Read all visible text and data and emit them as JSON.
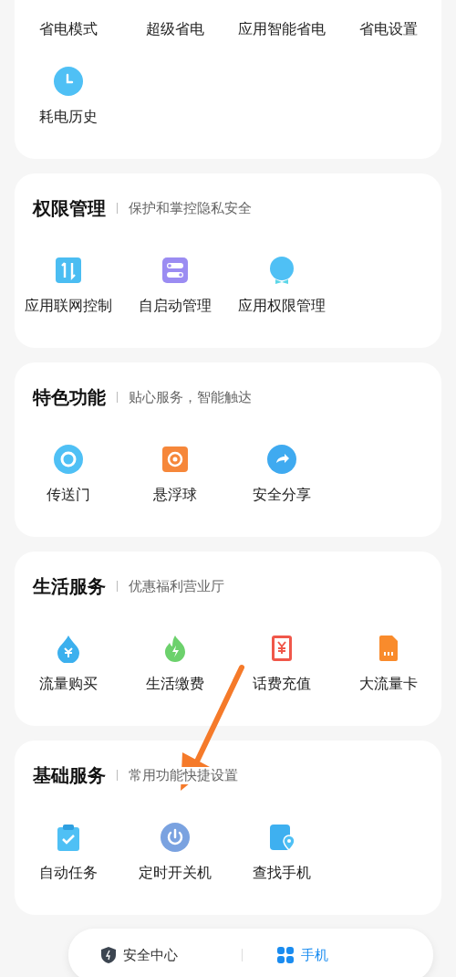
{
  "sections": [
    {
      "items": [
        {
          "label": "省电模式"
        },
        {
          "label": "超级省电"
        },
        {
          "label": "应用智能省电"
        },
        {
          "label": "省电设置"
        },
        {
          "label": "耗电历史"
        }
      ]
    },
    {
      "title": "权限管理",
      "subtitle": "保护和掌控隐私安全",
      "items": [
        {
          "label": "应用联网控制"
        },
        {
          "label": "自启动管理"
        },
        {
          "label": "应用权限管理"
        }
      ]
    },
    {
      "title": "特色功能",
      "subtitle": "贴心服务，智能触达",
      "items": [
        {
          "label": "传送门"
        },
        {
          "label": "悬浮球"
        },
        {
          "label": "安全分享"
        }
      ]
    },
    {
      "title": "生活服务",
      "subtitle": "优惠福利营业厅",
      "items": [
        {
          "label": "流量购买"
        },
        {
          "label": "生活缴费"
        },
        {
          "label": "话费充值"
        },
        {
          "label": "大流量卡"
        }
      ]
    },
    {
      "title": "基础服务",
      "subtitle": "常用功能快捷设置",
      "items": [
        {
          "label": "自动任务"
        },
        {
          "label": "定时开关机"
        },
        {
          "label": "查找手机"
        }
      ]
    }
  ],
  "nav": [
    {
      "label": "安全中心",
      "selected": false
    },
    {
      "label": "手机",
      "selected": true
    }
  ]
}
